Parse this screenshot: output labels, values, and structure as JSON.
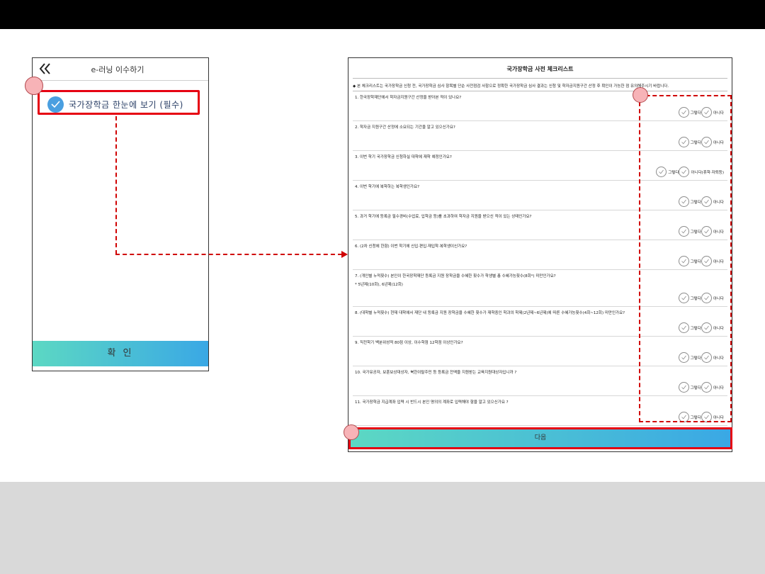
{
  "phone": {
    "title": "e-러닝 이수하기",
    "required_item_label": "국가장학금 한눈에 보기 (필수)",
    "confirm_label": "확 인"
  },
  "checklist": {
    "title": "국가장학금 사전 체크리스트",
    "notice": "◆ 본 체크리스트는 국가장학금 신청 전, 국가장학금 심사 항목별 단순 사전점검 사항으로 정확한 국가장학금 심사 결과는 신청 및 학자금지원구간 산정 후 확인이 가능한 점 유의해주시기 바랍니다.",
    "questions": [
      {
        "text": "1. 한국장학재단에서 학자금지원구간 산정을 받아본 적이 있나요?",
        "sub": "",
        "yes": "그렇다",
        "no": "아니다"
      },
      {
        "text": "2. 학자금 지원구간 산정에 소요되는 기간을 알고 있으신가요?",
        "sub": "",
        "yes": "그렇다",
        "no": "아니다"
      },
      {
        "text": "3. 이번 학기 국가장학금 신청하실 대학에 재학 예정인가요?",
        "sub": "",
        "yes": "그렇다",
        "no": "아니다(휴학·자퇴등)"
      },
      {
        "text": "4. 이번 학기에 복학하는 복학생인가요?",
        "sub": "",
        "yes": "그렇다",
        "no": "아니다"
      },
      {
        "text": "5. 과거 학기에 등록금 필수경비(수업료, 입학금 등)를 초과하여 학자금 지원을 받으신 적이 있는 상태인가요?",
        "sub": "",
        "yes": "그렇다",
        "no": "아니다"
      },
      {
        "text": "6. (2차 신청에 한함) 이번 학기에 신입·편입·재입학·복학생이신가요?",
        "sub": "",
        "yes": "그렇다",
        "no": "아니다"
      },
      {
        "text": "7. (개인별 누적횟수) 본인이 한국장학재단 등록금 지원 장학금을 수혜한 횟수가 학생별 총 수혜가능횟수(8회*) 미만인가요?",
        "sub": "* 5년제(10회), 6년제(12회)",
        "yes": "그렇다",
        "no": "아니다"
      },
      {
        "text": "8. (대학별 누적횟수) 현재 대학에서 재단 내 등록금 지원 장학금을 수혜한 횟수가 재학중인 학과의 학제(2년제~6년제)에 따른 수혜가능횟수(4회~12회) 미만인가요?",
        "sub": "",
        "yes": "그렇다",
        "no": "아니다"
      },
      {
        "text": "9. 직전학기 백분위성적 80점 이상, 이수학점 12학점 이상인가요?",
        "sub": "",
        "yes": "그렇다",
        "no": "아니다"
      },
      {
        "text": "10. 국가유공자, 보훈보상대상자, 북한이탈주민 등 등록금 전액을 지원받는 교육지원대상자입니까 ?",
        "sub": "",
        "yes": "그렇다",
        "no": "아니다"
      },
      {
        "text": "11. 국가장학금 지급계좌 입력 시 반드시 본인 명의의 계좌로 입력해야 함을 알고 있으신가요 ?",
        "sub": "",
        "yes": "그렇다",
        "no": "아니다"
      }
    ],
    "next_label": "다음"
  },
  "colors": {
    "highlight_red": "#e60012",
    "button_gradient_start": "#5cd8c3",
    "button_gradient_end": "#3aa8e5",
    "check_blue": "#4a9fe0",
    "marker_pink": "#f7b3b7"
  }
}
